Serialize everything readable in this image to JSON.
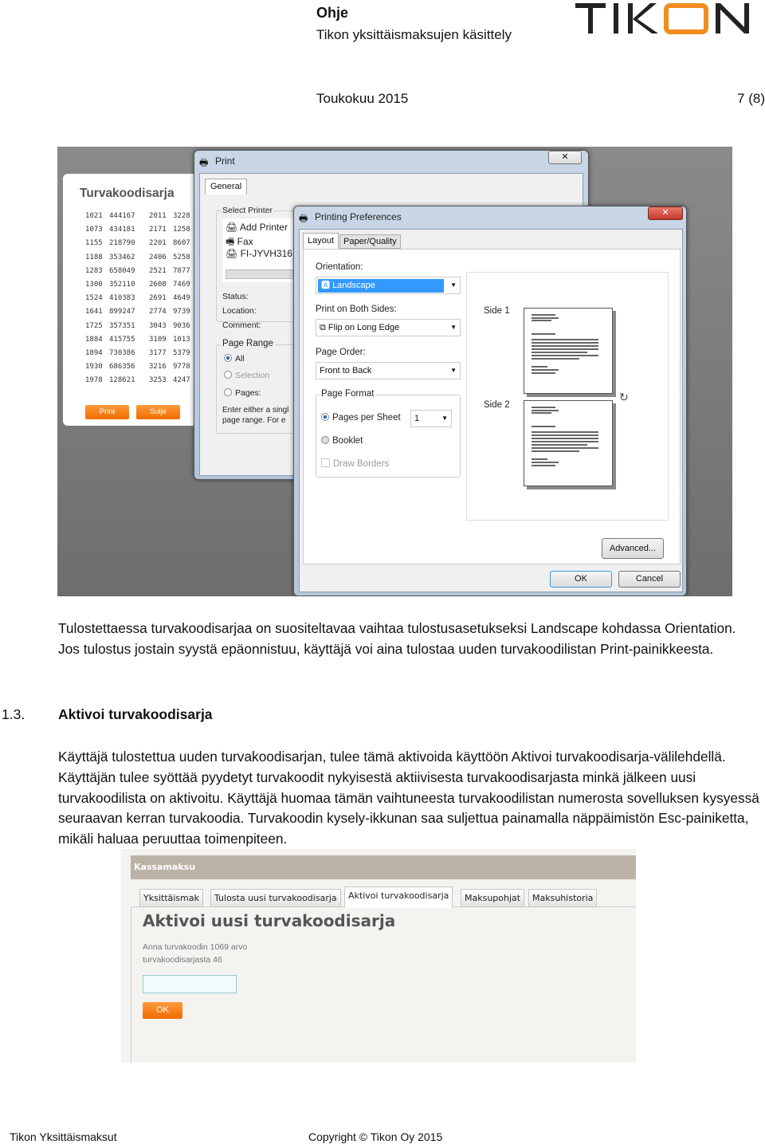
{
  "header": {
    "title": "Ohje",
    "subtitle": "Tikon yksittäismaksujen käsittely",
    "logo_text": "TIKON",
    "date": "Toukokuu 2015",
    "page": "7 (8)"
  },
  "screenshot1": {
    "panel_title": "Turvakoodisarja",
    "codes": [
      [
        "1021",
        "444167",
        "2011",
        "3228"
      ],
      [
        "1073",
        "434181",
        "2171",
        "1258"
      ],
      [
        "1155",
        "218790",
        "2201",
        "8607"
      ],
      [
        "1188",
        "353462",
        "2406",
        "5258"
      ],
      [
        "1283",
        "658049",
        "2521",
        "7877"
      ],
      [
        "1300",
        "352110",
        "2608",
        "7469"
      ],
      [
        "1524",
        "410383",
        "2691",
        "4649"
      ],
      [
        "1641",
        "899247",
        "2774",
        "9739"
      ],
      [
        "1725",
        "357351",
        "3043",
        "9036"
      ],
      [
        "1884",
        "415755",
        "3109",
        "1013"
      ],
      [
        "1894",
        "730386",
        "3177",
        "5379"
      ],
      [
        "1930",
        "686356",
        "3216",
        "9778"
      ],
      [
        "1978",
        "128621",
        "3253",
        "4247"
      ]
    ],
    "print_btn": "Print",
    "close_btn": "Sulje",
    "print_dialog": {
      "title": "Print",
      "tab": "General",
      "select_printer": "Select Printer",
      "printers": [
        "Add Printer",
        "Fax",
        "FI-JYVH316 c"
      ],
      "status": "Status:",
      "location": "Location:",
      "comment": "Comment:",
      "page_range": "Page Range",
      "all": "All",
      "selection": "Selection",
      "pages": "Pages:",
      "hint1": "Enter either a singl",
      "hint2": "page range.  For e"
    },
    "prefs": {
      "title": "Printing Preferences",
      "tabs": [
        "Layout",
        "Paper/Quality"
      ],
      "orientation_label": "Orientation:",
      "orientation": "Landscape",
      "both_sides_label": "Print on Both Sides:",
      "both_sides": "Flip on Long Edge",
      "page_order_label": "Page Order:",
      "page_order": "Front to Back",
      "page_format": "Page Format",
      "pages_per_sheet": "Pages per Sheet",
      "pps_value": "1",
      "booklet": "Booklet",
      "draw_borders": "Draw Borders",
      "side1": "Side 1",
      "side2": "Side 2",
      "advanced": "Advanced...",
      "ok": "OK",
      "cancel": "Cancel"
    }
  },
  "paragraph1": "Tulostettaessa turvakoodisarjaa on suositeltavaa vaihtaa tulostusasetukseksi Landscape kohdassa Orientation. Jos tulostus jostain syystä epäonnistuu, käyttäjä voi aina tulostaa uuden turvakoodilistan Print-painikkeesta.",
  "section": {
    "number": "1.3.",
    "title": "Aktivoi turvakoodisarja"
  },
  "paragraph2": "Käyttäjä tulostettua uuden turvakoodisarjan, tulee tämä aktivoida käyttöön Aktivoi turvakoodisarja-välilehdellä. Käyttäjän tulee syöttää pyydetyt turvakoodit nykyisestä aktiivisesta turvakoodisarjasta minkä jälkeen uusi turvakoodilista on aktivoitu. Käyttäjä huomaa tämän vaihtuneesta turvakoodilistan numerosta sovelluksen kysyessä seuraavan kerran turvakoodia. Turvakoodin kysely-ikkunan saa suljettua painamalla näppäimistön Esc-painiketta, mikäli haluaa peruuttaa toimenpiteen.",
  "screenshot2": {
    "bar": "Kassamaksu",
    "tabs": [
      "Yksittäismak",
      "Tulosta uusi turvakoodisarja",
      "Aktivoi turvakoodisarja",
      "Maksupohjat",
      "Maksuhistoria"
    ],
    "heading": "Aktivoi uusi turvakoodisarja",
    "prompt1": "Anna turvakoodin 1069 arvo",
    "prompt2": "turvakoodisarjasta 46",
    "input_value": "",
    "ok": "OK"
  },
  "footer": {
    "left": "Tikon Yksittäismaksut",
    "center": "Copyright © Tikon Oy 2015"
  },
  "colors": {
    "orange": "#f28c1e",
    "selection_blue": "#3399ff",
    "tab_bar": "#bdb2a6"
  }
}
